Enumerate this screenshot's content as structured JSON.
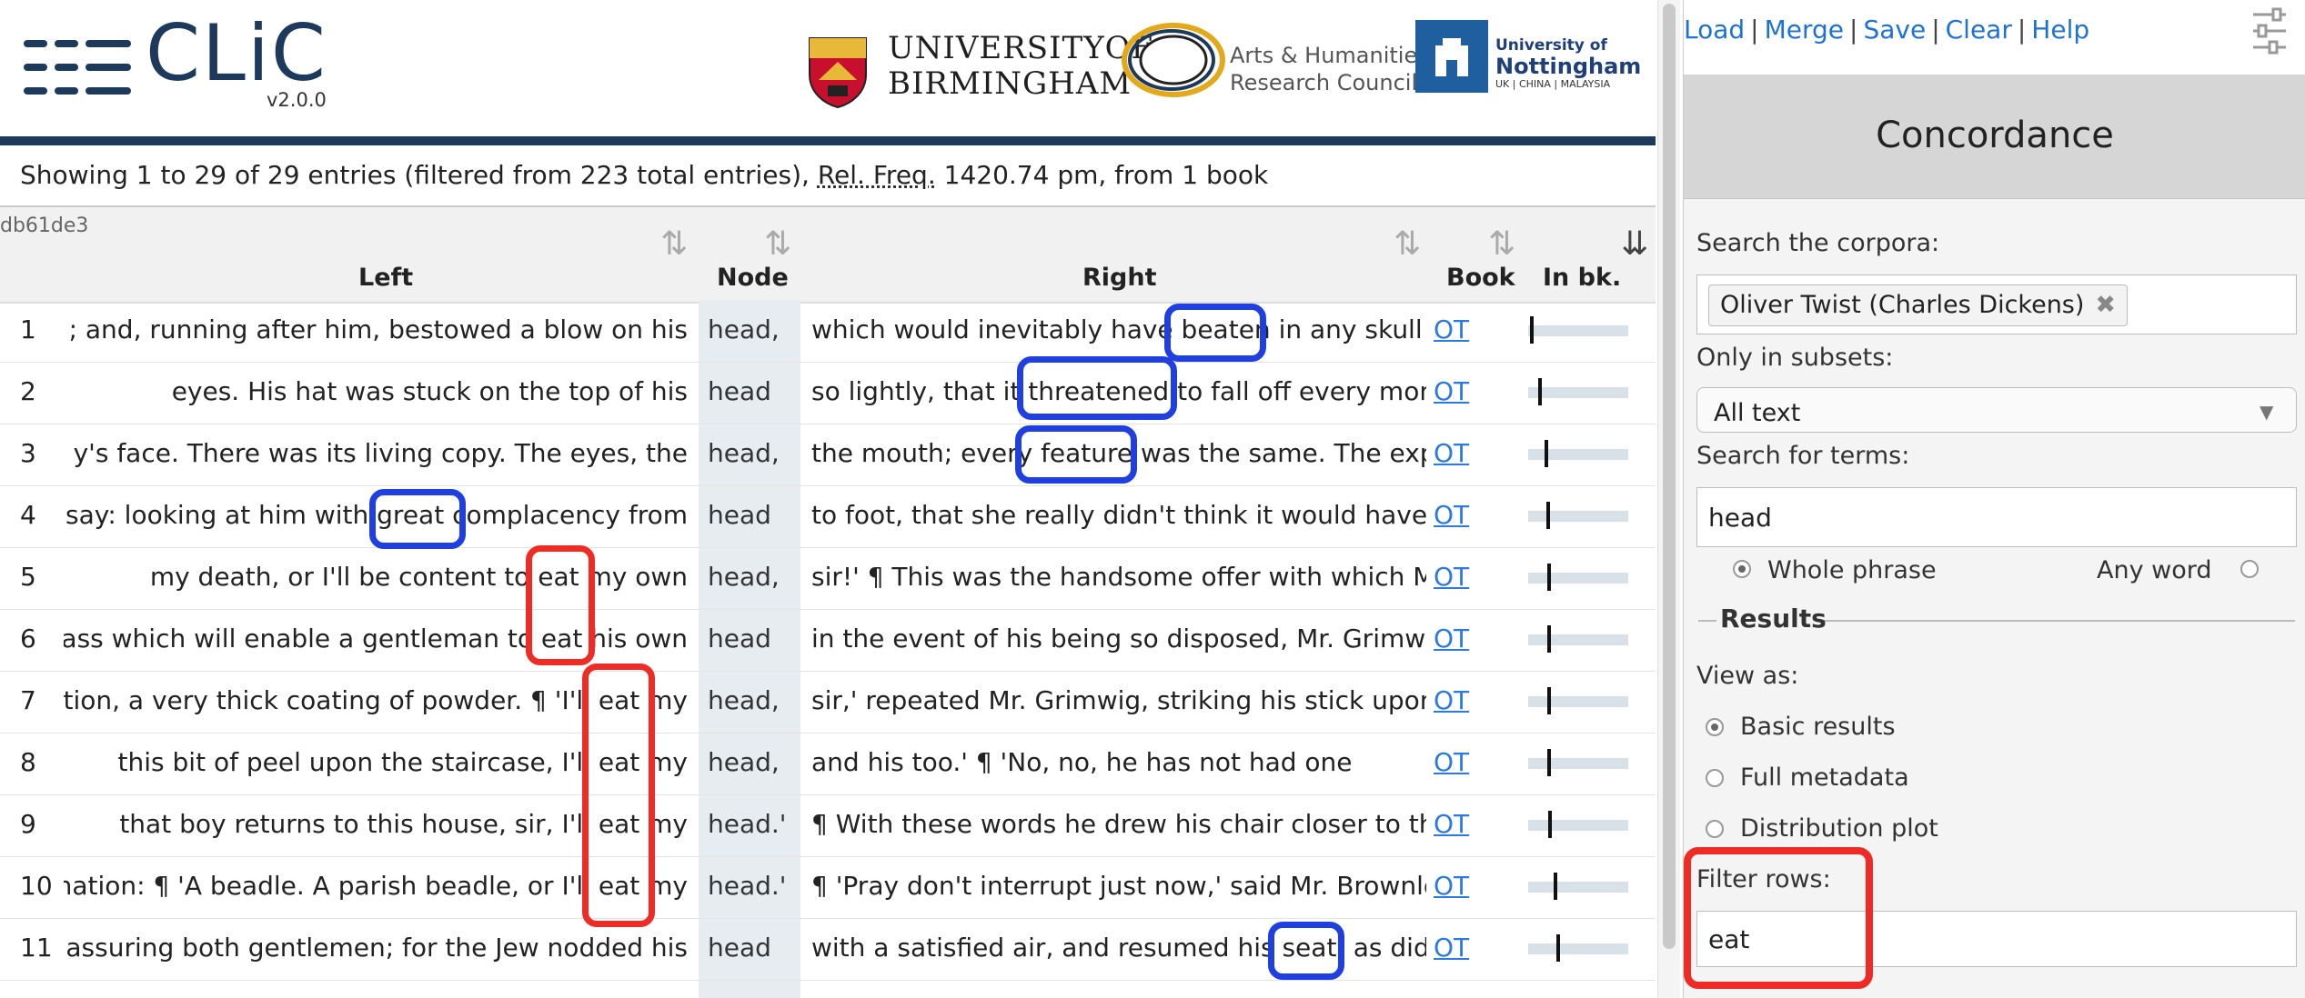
{
  "app": {
    "name": "CLiC",
    "version": "v2.0.0"
  },
  "partners": {
    "uob_line1": "UNIVERSITYOF",
    "uob_line2": "BIRMINGHAM",
    "ahrc_line1": "Arts & Humanities",
    "ahrc_line2": "Research Council",
    "uon_line1": "University of",
    "uon_line2": "Nottingham",
    "uon_line3": "UK | CHINA | MALAYSIA"
  },
  "summary": {
    "prefix": "Showing 1 to 29 of 29 entries (filtered from 223 total entries),",
    "relfreq_label": "Rel. Freq.",
    "suffix": "1420.74 pm, from 1 book"
  },
  "table_id": "db61de3",
  "columns": {
    "left": "Left",
    "node": "Node",
    "right": "Right",
    "book": "Book",
    "inbk": "In bk."
  },
  "sort_icons": [
    "sort-arrows-icon",
    "sort-arrows-icon",
    "sort-arrows-icon",
    "sort-arrows-icon",
    "sort-desc-icon"
  ],
  "rows": [
    {
      "num": "1",
      "left": "; and, running after him, bestowed a blow on his",
      "node": "head,",
      "right": "which would inevitably have beaten in any skull b",
      "book": "OT",
      "pos": 0.02
    },
    {
      "num": "2",
      "left": "eyes. His hat was stuck on the top of his",
      "node": "head",
      "right": "so lightly, that it threatened to fall off every mom",
      "book": "OT",
      "pos": 0.1
    },
    {
      "num": "3",
      "left": "y's face. There was its living copy. The eyes, the",
      "node": "head,",
      "right": "the mouth; every feature was the same. The expr",
      "book": "OT",
      "pos": 0.17
    },
    {
      "num": "4",
      "left": "say: looking at him with great complacency from",
      "node": "head",
      "right": "to foot, that she really didn't think it would have",
      "book": "OT",
      "pos": 0.19
    },
    {
      "num": "5",
      "left": "my death, or I'll be content to eat my own",
      "node": "head,",
      "right": "sir!' ¶ This was the handsome offer with which M",
      "book": "OT",
      "pos": 0.2
    },
    {
      "num": "6",
      "left": "ass which will enable a gentleman to eat his own",
      "node": "head",
      "right": "in the event of his being so disposed, Mr. Grimwi",
      "book": "OT",
      "pos": 0.2
    },
    {
      "num": "7",
      "left": "tion, a very thick coating of powder. ¶ 'I'll eat my",
      "node": "head,",
      "right": "sir,' repeated Mr. Grimwig, striking his stick upon",
      "book": "OT",
      "pos": 0.2
    },
    {
      "num": "8",
      "left": "this bit of peel upon the staircase, I'll eat my",
      "node": "head,",
      "right": "and his too.' ¶ 'No, no, he has not had one",
      "book": "OT",
      "pos": 0.2
    },
    {
      "num": "9",
      "left": "that boy returns to this house, sir, I'll eat my",
      "node": "head.'",
      "right": "¶ With these words he drew his chair closer to th",
      "book": "OT",
      "pos": 0.21
    },
    {
      "num": "10",
      "left": "nation: ¶ 'A beadle. A parish beadle, or I'll eat my",
      "node": "head.'",
      "right": "¶ 'Pray don't interrupt just now,' said Mr. Brownlo",
      "book": "OT",
      "pos": 0.26
    },
    {
      "num": "11",
      "left": "assuring both gentlemen; for the Jew nodded his",
      "node": "head",
      "right": "with a satisfied air, and resumed his seat: as did",
      "book": "OT",
      "pos": 0.29
    }
  ],
  "panel": {
    "links": [
      "Load",
      "Merge",
      "Save",
      "Clear",
      "Help"
    ],
    "title": "Concordance",
    "search_corpora_label": "Search the corpora:",
    "corpus_tag": "Oliver Twist (Charles Dickens)",
    "subsets_label": "Only in subsets:",
    "subset_value": "All text",
    "terms_label": "Search for terms:",
    "terms_value": "head",
    "whole_phrase": "Whole phrase",
    "any_word": "Any word",
    "results_legend": "Results",
    "view_as_label": "View as:",
    "view_basic": "Basic results",
    "view_full": "Full metadata",
    "view_dist": "Distribution plot",
    "filter_label": "Filter rows:",
    "filter_value": "eat"
  },
  "colors": {
    "brand": "#1d3a5c",
    "link": "#1d72d8",
    "annotation_blue": "#1f3fe0",
    "annotation_red": "#ee2b24"
  }
}
